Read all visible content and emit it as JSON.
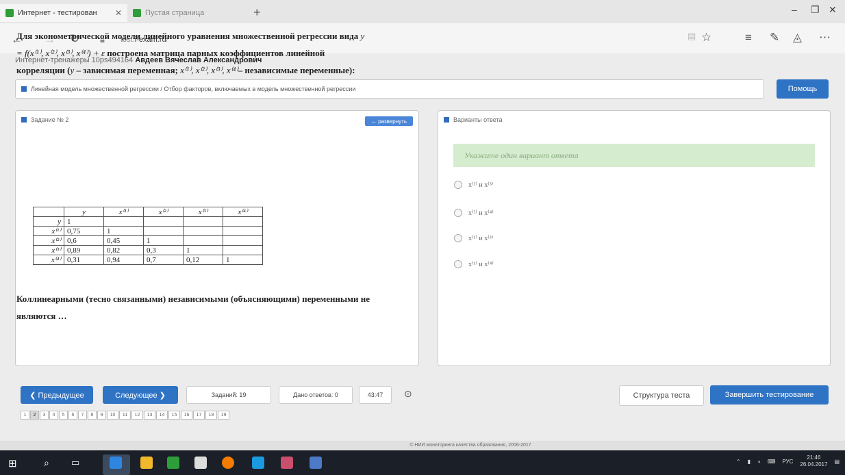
{
  "browser": {
    "tab1_title": "Интернет - тестирован",
    "tab2_title": "Пустая страница",
    "url_host": "i-exam.ru",
    "url_rest": "/",
    "url_prefix": "test."
  },
  "header": {
    "prefix": "Интернет-тренажеры 10ps494164",
    "user": "Авдеев Вячеслав Александрович"
  },
  "breadcrumb": "Линейная модель множественной регрессии / Отбор факторов, включаемых в модель множественной регрессии",
  "help_label": "Помощь",
  "task": {
    "title": "Задание № 2",
    "expand_label": "↔ развернуть",
    "text_1": "Для эконометрической модели линейного уравнения множественной регрессии вида",
    "formula": "y = f(x⁽¹⁾, x⁽²⁾, x⁽³⁾, x⁽⁴⁾) + ε",
    "text_2": "построена матрица парных коэффициентов линейной корреляции (",
    "text_y": "y",
    "text_3": " – зависимая переменная;",
    "text_vars": "x⁽¹⁾, x⁽²⁾, x⁽³⁾, x⁽⁴⁾",
    "text_4": "– независимые переменные):",
    "table": {
      "headers": [
        "",
        "y",
        "x⁽¹⁾",
        "x⁽²⁾",
        "x⁽³⁾",
        "x⁽⁴⁾"
      ],
      "rows": [
        [
          "y",
          "1",
          "",
          "",
          "",
          ""
        ],
        [
          "x⁽¹⁾",
          "0,75",
          "1",
          "",
          "",
          ""
        ],
        [
          "x⁽²⁾",
          "0,6",
          "0,45",
          "1",
          "",
          ""
        ],
        [
          "x⁽³⁾",
          "0,89",
          "0,82",
          "0,3",
          "1",
          ""
        ],
        [
          "x⁽⁴⁾",
          "0,31",
          "0,94",
          "0,7",
          "0,12",
          "1"
        ]
      ]
    },
    "tail_1": "Коллинеарными (тесно связанными) независимыми (объясняющими) переменными",
    "tail_bold": "не являются",
    "tail_2": " …"
  },
  "answers": {
    "title": "Варианты ответа",
    "hint": "Укажите один вариант ответа",
    "options": [
      "x⁽²⁾ и x⁽³⁾",
      "x⁽²⁾ и x⁽⁴⁾",
      "x⁽¹⁾ и x⁽³⁾",
      "x⁽¹⁾ и x⁽⁴⁾"
    ]
  },
  "nav": {
    "prev": "❮ Предыдущее",
    "next": "Следующее ❯",
    "tasks": "Заданий: 19",
    "given": "Дано ответов: 0",
    "timer": "43:47",
    "structure": "Структура теста",
    "finish": "Завершить тестирование",
    "pages": [
      "1",
      "2",
      "3",
      "4",
      "5",
      "6",
      "7",
      "8",
      "9",
      "10",
      "11",
      "12",
      "13",
      "14",
      "15",
      "16",
      "17",
      "18",
      "19"
    ],
    "current_page": "2"
  },
  "footer": "© НИИ мониторинга качества образования, 2006-2017",
  "taskbar": {
    "lang": "РУС",
    "time": "21:46",
    "date": "26.04.2017"
  }
}
